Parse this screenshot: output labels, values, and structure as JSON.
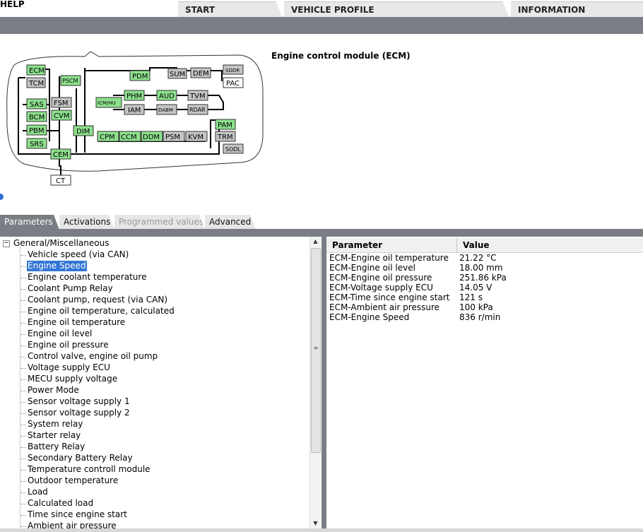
{
  "header": {
    "help_label": "HELP",
    "tabs": [
      {
        "label": "START"
      },
      {
        "label": "VEHICLE PROFILE"
      },
      {
        "label": "INFORMATION"
      }
    ]
  },
  "diagram": {
    "title": "Engine control module (ECM)",
    "modules": [
      {
        "label": "ECM",
        "color": "green"
      },
      {
        "label": "TCM",
        "color": "gray"
      },
      {
        "label": "PSCM",
        "color": "green"
      },
      {
        "label": "PDM",
        "color": "green"
      },
      {
        "label": "SUM",
        "color": "gray"
      },
      {
        "label": "DEM",
        "color": "gray"
      },
      {
        "label": "SODR",
        "color": "gray"
      },
      {
        "label": "PAC",
        "color": "white"
      },
      {
        "label": "PHM",
        "color": "green"
      },
      {
        "label": "AUD",
        "color": "green"
      },
      {
        "label": "TVM",
        "color": "gray"
      },
      {
        "label": "ICM/HU",
        "color": "green"
      },
      {
        "label": "IAM",
        "color": "gray"
      },
      {
        "label": "DABM",
        "color": "gray"
      },
      {
        "label": "RDAR",
        "color": "gray"
      },
      {
        "label": "SAS",
        "color": "green"
      },
      {
        "label": "FSM",
        "color": "gray"
      },
      {
        "label": "BCM",
        "color": "green"
      },
      {
        "label": "CVM",
        "color": "green"
      },
      {
        "label": "PBM",
        "color": "green"
      },
      {
        "label": "DIM",
        "color": "green"
      },
      {
        "label": "CPM",
        "color": "green"
      },
      {
        "label": "CCM",
        "color": "green"
      },
      {
        "label": "DDM",
        "color": "green"
      },
      {
        "label": "PSM",
        "color": "gray"
      },
      {
        "label": "KVM",
        "color": "gray"
      },
      {
        "label": "PAM",
        "color": "green"
      },
      {
        "label": "TRM",
        "color": "gray"
      },
      {
        "label": "SRS",
        "color": "green"
      },
      {
        "label": "SODL",
        "color": "gray"
      },
      {
        "label": "CEM",
        "color": "green"
      },
      {
        "label": "CT",
        "color": "white"
      }
    ],
    "colors": {
      "green": "#8de08d",
      "gray": "#c4c4c4",
      "white": "#ffffff"
    }
  },
  "bottom_tabs": [
    {
      "label": "Parameters",
      "state": "active"
    },
    {
      "label": "Activations",
      "state": "normal"
    },
    {
      "label": "Programmed values",
      "state": "disabled"
    },
    {
      "label": "Advanced",
      "state": "normal"
    }
  ],
  "tree": {
    "root_label": "General/Miscellaneous",
    "root_expander": "−",
    "items": [
      "Vehicle speed (via CAN)",
      "Engine Speed",
      "Engine coolant temperature",
      "Coolant Pump Relay",
      "Coolant pump, request (via CAN)",
      "Engine oil temperature, calculated",
      "Engine oil temperature",
      "Engine oil level",
      "Engine oil pressure",
      "Control valve, engine oil pump",
      "Voltage supply ECU",
      "MECU supply voltage",
      "Power Mode",
      "Sensor voltage supply 1",
      "Sensor voltage supply 2",
      "System relay",
      "Starter relay",
      "Battery Relay",
      "Secondary Battery Relay",
      "Temperature controll module",
      "Outdoor temperature",
      "Load",
      "Calculated load",
      "Time since engine start",
      "Ambient air pressure"
    ],
    "selected_item": "Engine Speed"
  },
  "table": {
    "headers": {
      "parameter": "Parameter",
      "value": "Value"
    },
    "rows": [
      {
        "parameter": "ECM-Engine oil temperature",
        "value": "21.22 °C"
      },
      {
        "parameter": "ECM-Engine oil level",
        "value": "18.00 mm"
      },
      {
        "parameter": "ECM-Engine oil pressure",
        "value": "251.86 kPa"
      },
      {
        "parameter": "ECM-Voltage supply ECU",
        "value": "14.05 V"
      },
      {
        "parameter": "ECM-Time since engine start",
        "value": "121 s"
      },
      {
        "parameter": "ECM-Ambient air pressure",
        "value": "100 kPa"
      },
      {
        "parameter": "ECM-Engine Speed",
        "value": "836 r/min"
      }
    ]
  },
  "colors": {
    "chrome_gray": "#7a7d84",
    "selection_blue": "#3375d6"
  }
}
